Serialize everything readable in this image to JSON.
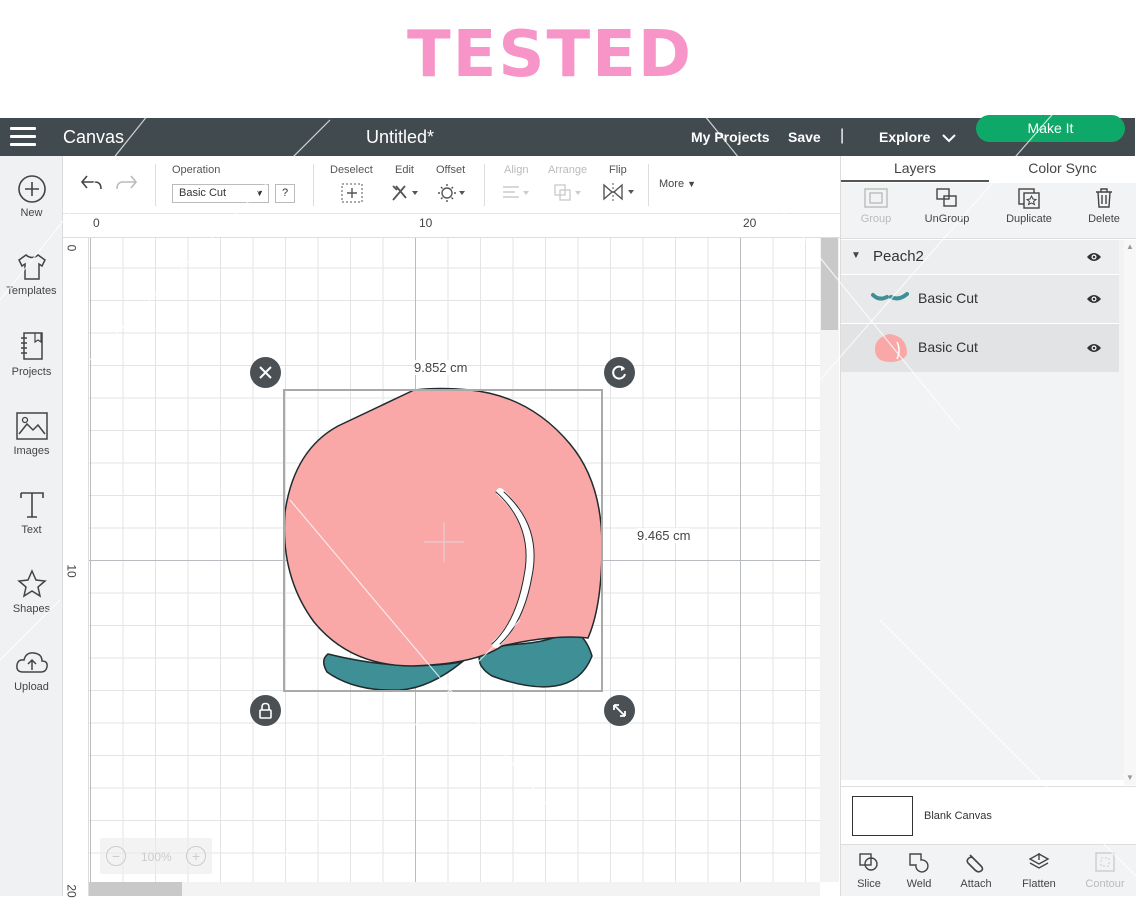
{
  "banner": {
    "title": "TESTED",
    "color": "#f794c8"
  },
  "topbar": {
    "app_title": "Canvas",
    "doc_title": "Untitled*",
    "my_projects": "My Projects",
    "save": "Save",
    "separator": "|",
    "explore": "Explore",
    "make_it": "Make It"
  },
  "sidebar": {
    "items": [
      {
        "label": "New",
        "icon": "plus-circle-icon"
      },
      {
        "label": "Templates",
        "icon": "tshirt-icon"
      },
      {
        "label": "Projects",
        "icon": "notebook-icon"
      },
      {
        "label": "Images",
        "icon": "image-icon"
      },
      {
        "label": "Text",
        "icon": "text-icon"
      },
      {
        "label": "Shapes",
        "icon": "shapes-icon"
      },
      {
        "label": "Upload",
        "icon": "cloud-upload-icon"
      }
    ]
  },
  "toolbar": {
    "operation_label": "Operation",
    "operation_value": "Basic Cut",
    "help": "?",
    "deselect": "Deselect",
    "edit": "Edit",
    "offset": "Offset",
    "align": "Align",
    "arrange": "Arrange",
    "flip": "Flip",
    "more": "More"
  },
  "rulers": {
    "horizontal": [
      "0",
      "10",
      "20"
    ],
    "vertical": [
      "0",
      "10",
      "20"
    ]
  },
  "canvas": {
    "width_label": "9.852 cm",
    "height_label": "9.465 cm",
    "zoom": "100%"
  },
  "panel": {
    "tabs": [
      "Layers",
      "Color Sync"
    ],
    "tools": [
      {
        "label": "Group",
        "enabled": false
      },
      {
        "label": "UnGroup",
        "enabled": true
      },
      {
        "label": "Duplicate",
        "enabled": true
      },
      {
        "label": "Delete",
        "enabled": true
      }
    ],
    "group_name": "Peach2",
    "layers": [
      {
        "name": "Basic Cut",
        "color": "#3f8f96"
      },
      {
        "name": "Basic Cut",
        "color": "#f9a7a7"
      }
    ],
    "blank_canvas": "Blank Canvas",
    "bottom_tools": [
      {
        "label": "Slice",
        "enabled": true
      },
      {
        "label": "Weld",
        "enabled": true
      },
      {
        "label": "Attach",
        "enabled": true
      },
      {
        "label": "Flatten",
        "enabled": true
      },
      {
        "label": "Contour",
        "enabled": false
      }
    ]
  },
  "colors": {
    "topbar": "#414a4f",
    "make_it": "#0ea969",
    "peach": "#f9a7a7",
    "leaf": "#3f8f96"
  }
}
